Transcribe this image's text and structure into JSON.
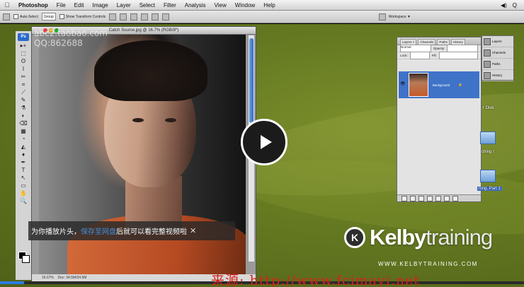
{
  "menubar": {
    "apple_icon": "apple-icon",
    "items": [
      "Photoshop",
      "File",
      "Edit",
      "Image",
      "Layer",
      "Select",
      "Filter",
      "Analysis",
      "View",
      "Window",
      "Help"
    ],
    "status_icons": [
      "◀)",
      "Q"
    ]
  },
  "optionsbar": {
    "auto_select_label": "Auto-Select",
    "auto_select_value": "Group",
    "transform_label": "Show Transform Controls",
    "workspace_label": "Workspace ▼"
  },
  "document": {
    "title": "Catch Source.jpg @ 16.7% (RGB/8*)",
    "zoom": "16.67%",
    "doc_info": "Doc: 34.5M/34.5M"
  },
  "toolbox": {
    "logo": "Ps",
    "tools": [
      "▸+",
      "⬚",
      "ʘ",
      "⌇",
      "✂",
      "⌗",
      "⟋",
      "✎",
      "⚗",
      "◐",
      "⌫",
      "▦",
      "◔",
      "◭",
      "♦",
      "✒",
      "T",
      "↖",
      "▭",
      "✋",
      "🔍"
    ]
  },
  "layers_panel": {
    "tabs": [
      "Layers ×",
      "Channels",
      "Paths",
      "History"
    ],
    "blend_mode": "Normal",
    "opacity_label": "Opacity:",
    "lock_label": "Lock:",
    "fill_label": "Fill:",
    "layer_name": "Background"
  },
  "dock_panel": {
    "items": [
      "Layers",
      "Channels",
      "Paths",
      "History"
    ]
  },
  "desktop_labels": [
    "r Disk",
    "ching /",
    "ning, Part 1"
  ],
  "watermark": {
    "line1": "abc2.taobao.com",
    "line2": "QQ:862688"
  },
  "tip": {
    "text_before": "为你播放片头，",
    "link": "保存至网盘",
    "text_after": "后就可以看完整视频啦",
    "close": "✕"
  },
  "kelby": {
    "badge": "K",
    "brand_kelby": "Kelby",
    "brand_training": "training",
    "url": "WWW.KELBYTRAINING.COM"
  },
  "source_watermark": "来源: http://www.fcimayi.net",
  "video": {
    "progress": 0.046
  }
}
